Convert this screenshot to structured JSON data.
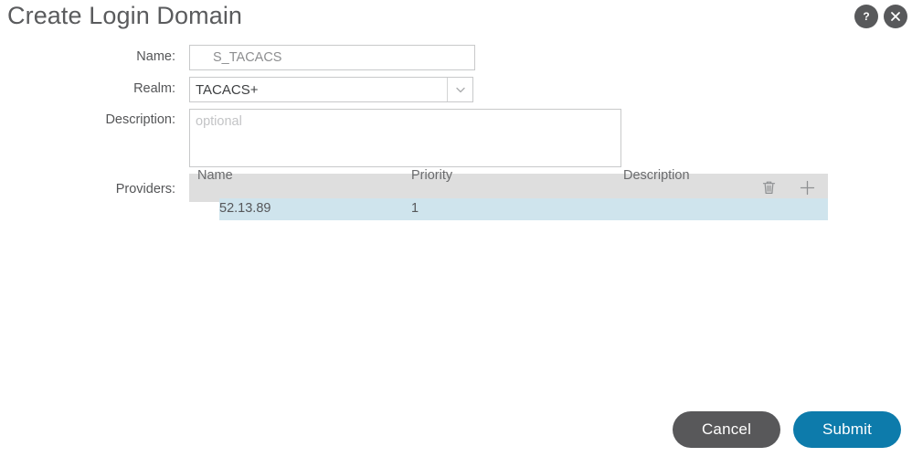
{
  "dialog": {
    "title": "Create Login Domain",
    "help_icon": "help-question-icon",
    "close_icon": "close-x-icon"
  },
  "form": {
    "name": {
      "label": "Name:",
      "value": "S_TACACS",
      "placeholder": ""
    },
    "realm": {
      "label": "Realm:",
      "value": "TACACS+",
      "arrow_icon": "chevron-down-icon"
    },
    "description": {
      "label": "Description:",
      "value": "",
      "placeholder": "optional"
    },
    "providers": {
      "label": "Providers:",
      "delete_icon": "trash-icon",
      "add_icon": "plus-icon",
      "columns": [
        "Name",
        "Priority",
        "Description"
      ],
      "rows": [
        {
          "name": "52.13.89",
          "priority": "1",
          "description": ""
        }
      ]
    }
  },
  "footer": {
    "cancel_label": "Cancel",
    "submit_label": "Submit"
  },
  "colors": {
    "submit_blue": "#0d7bab",
    "cancel_gray": "#58585a",
    "toolbar_gray": "#dedede",
    "selected_row_blue": "#cfe4ed",
    "title_gray": "#5a5b5d"
  }
}
